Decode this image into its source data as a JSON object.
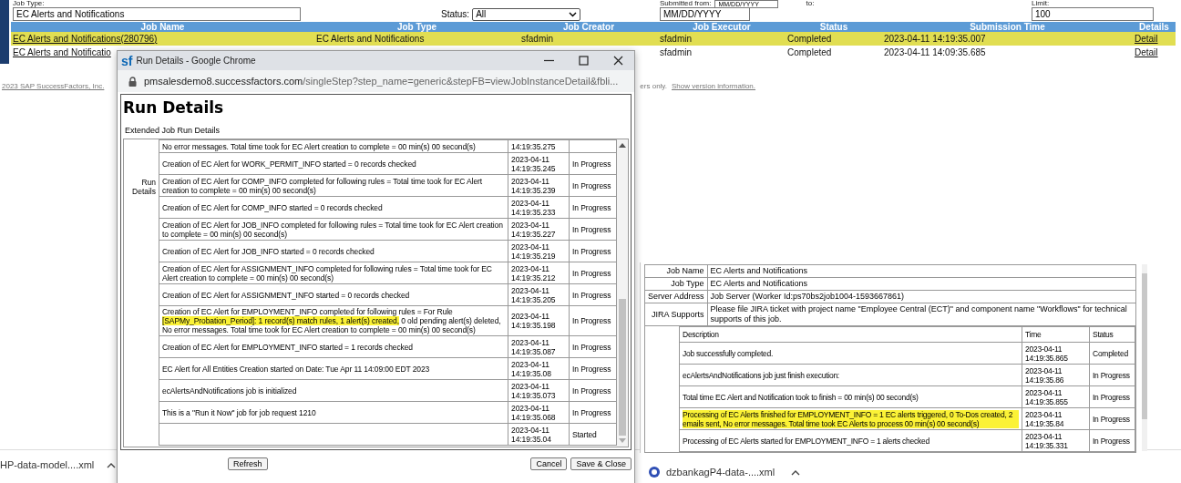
{
  "filters": {
    "job_type_label": "Job Type:",
    "job_type_value": "EC Alerts and Notifications",
    "status_label": "Status:",
    "status_value": "All",
    "submitted_from_label": "Submitted from:",
    "from_value": "MM/DD/YYYY",
    "to_label": "to:",
    "to_value": "MM/DD/YYYY",
    "limit_label": "Limit:",
    "limit_value": "100"
  },
  "jobs_table": {
    "columns": [
      "Job Name",
      "Job Type",
      "Job Creator",
      "Job Executor",
      "Status",
      "Submission Time",
      "Details"
    ],
    "rows": [
      {
        "selected": true,
        "cells": [
          "EC Alerts and Notifications(280796)",
          "EC Alerts and Notifications",
          "sfadmin",
          "sfadmin",
          "Completed",
          "2023-04-11 14:19:35.007",
          "Detail"
        ]
      },
      {
        "selected": false,
        "cells": [
          "EC Alerts and Notificatio",
          null,
          null,
          "sfadmin",
          "Completed",
          "2023-04-11 14:09:35.685",
          "Detail"
        ]
      }
    ]
  },
  "footer": {
    "copyright": "2023 SAP SuccessFactors, Inc.",
    "notice": "ers only.",
    "version_link": "Show version information."
  },
  "downloads": [
    {
      "name": "HP-data-model....xml",
      "icon": false
    },
    {
      "name": "dzbankagP4-data-....xml",
      "icon": true
    }
  ],
  "popup": {
    "logo": "sf",
    "title": "Run Details - Google Chrome",
    "url_host": "pmsalesdemo8.successfactors.com",
    "url_path": "/singleStep?step_name=generic&stepFB=viewJobInstanceDetail&fbli...",
    "heading": "Run Details",
    "subtitle": "Extended Job Run Details",
    "side_label": "Run Details",
    "rows": [
      {
        "segments": [
          {
            "text": "No error messages. Total time took for EC Alert creation to complete = 00 min(s) 00 second(s)",
            "highlighted": false
          }
        ],
        "time": "14:19:35.275"
      },
      {
        "segments": [
          {
            "text": "Creation of EC Alert for WORK_PERMIT_INFO started = 0 records checked",
            "highlighted": false
          }
        ],
        "date": "2023-04-11",
        "time": "14:19:35.245",
        "status": "In Progress"
      },
      {
        "segments": [
          {
            "text": "Creation of EC Alert for COMP_INFO completed for following rules = Total time took for EC Alert creation to complete = 00 min(s) 00 second(s)",
            "highlighted": false
          }
        ],
        "date": "2023-04-11",
        "time": "14:19:35.239",
        "status": "In Progress"
      },
      {
        "segments": [
          {
            "text": "Creation of EC Alert for COMP_INFO started = 0 records checked",
            "highlighted": false
          }
        ],
        "date": "2023-04-11",
        "time": "14:19:35.233",
        "status": "In Progress"
      },
      {
        "segments": [
          {
            "text": "Creation of EC Alert for JOB_INFO completed for following rules = Total time took for EC Alert creation to complete = 00 min(s) 00 second(s)",
            "highlighted": false
          }
        ],
        "date": "2023-04-11",
        "time": "14:19:35.227",
        "status": "In Progress"
      },
      {
        "segments": [
          {
            "text": "Creation of EC Alert for JOB_INFO started = 0 records checked",
            "highlighted": false
          }
        ],
        "date": "2023-04-11",
        "time": "14:19:35.219",
        "status": "In Progress"
      },
      {
        "segments": [
          {
            "text": "Creation of EC Alert for ASSIGNMENT_INFO completed for following rules = Total time took for EC Alert creation to complete = 00 min(s) 00 second(s)",
            "highlighted": false
          }
        ],
        "date": "2023-04-11",
        "time": "14:19:35.212",
        "status": "In Progress"
      },
      {
        "segments": [
          {
            "text": "Creation of EC Alert for ASSIGNMENT_INFO started = 0 records checked",
            "highlighted": false
          }
        ],
        "date": "2023-04-11",
        "time": "14:19:35.205",
        "status": "In Progress"
      },
      {
        "segments": [
          {
            "text": "Creation of EC Alert for EMPLOYMENT_INFO completed for following rules = For Rule ",
            "highlighted": false
          },
          {
            "text": "[SAPMy_Probation_Period]: 1 record(s) match rules, 1 alert(s) created,",
            "highlighted": true
          },
          {
            "text": " 0 old pending alert(s) deleted, No error messages. Total time took for EC Alert creation to complete = 00 min(s) 00 second(s)",
            "highlighted": false
          }
        ],
        "date": "2023-04-11",
        "time": "14:19:35.198",
        "status": "In Progress"
      },
      {
        "segments": [
          {
            "text": "Creation of EC Alert for EMPLOYMENT_INFO started = 1 records checked",
            "highlighted": false
          }
        ],
        "date": "2023-04-11",
        "time": "14:19:35.087",
        "status": "In Progress"
      },
      {
        "segments": [
          {
            "text": "EC Alert for All Entities Creation started on Date: Tue Apr 11 14:09:00 EDT 2023",
            "highlighted": false
          }
        ],
        "date": "2023-04-11",
        "time": "14:19:35.08",
        "status": "In Progress"
      },
      {
        "segments": [
          {
            "text": "ecAlertsAndNotifications job is initialized",
            "highlighted": false
          }
        ],
        "date": "2023-04-11",
        "time": "14:19:35.073",
        "status": "In Progress"
      },
      {
        "segments": [
          {
            "text": "This is a \"Run it Now\" job for job request 1210",
            "highlighted": false
          }
        ],
        "date": "2023-04-11",
        "time": "14:19:35.068",
        "status": "In Progress"
      },
      {
        "date": "2023-04-11",
        "time": "14:19:35.04",
        "status": "Started"
      }
    ],
    "buttons": [
      "Refresh",
      "Cancel",
      "Save & Close"
    ]
  },
  "detail_panel": {
    "info": [
      {
        "label": "Job Name",
        "value": "EC Alerts and Notifications"
      },
      {
        "label": "Job Type",
        "value": "EC Alerts and Notifications"
      },
      {
        "label": "Server Address",
        "value": "Job Server (Worker Id:ps70bs2job1004-1593667861)"
      },
      {
        "label": "JIRA Supports",
        "value": "Please file JIRA ticket with project name \"Employee Central (ECT)\" and component name \"Workflows\" for technical supports of this job."
      }
    ],
    "columns": [
      "Description",
      "Time",
      "Status"
    ],
    "rows": [
      {
        "description": "Job successfully completed.",
        "highlighted": false,
        "date": "2023-04-11",
        "time": "14:19:35.865",
        "status": "Completed"
      },
      {
        "description": "ecAlertsAndNotifications job just finish execution:",
        "highlighted": false,
        "date": "2023-04-11",
        "time": "14:19:35.86",
        "status": "In Progress"
      },
      {
        "description": "Total time EC Alert and Notification took to finish = 00 min(s) 00 second(s)",
        "highlighted": false,
        "date": "2023-04-11",
        "time": "14:19:35.855",
        "status": "In Progress"
      },
      {
        "description": "Processing of EC Alerts finished for EMPLOYMENT_INFO = 1 EC alerts triggered, 0 To-Dos created, 2 emails sent, No error messages. Total time took EC Alerts to process 00 min(s) 00 second(s)",
        "highlighted": true,
        "date": "2023-04-11",
        "time": "14:19:35.84",
        "status": "In Progress"
      },
      {
        "description": "Processing of EC Alerts started for EMPLOYMENT_INFO = 1 alerts checked",
        "highlighted": false,
        "date": "2023-04-11",
        "time": "14:19:35.331",
        "status": "In Progress"
      }
    ]
  }
}
